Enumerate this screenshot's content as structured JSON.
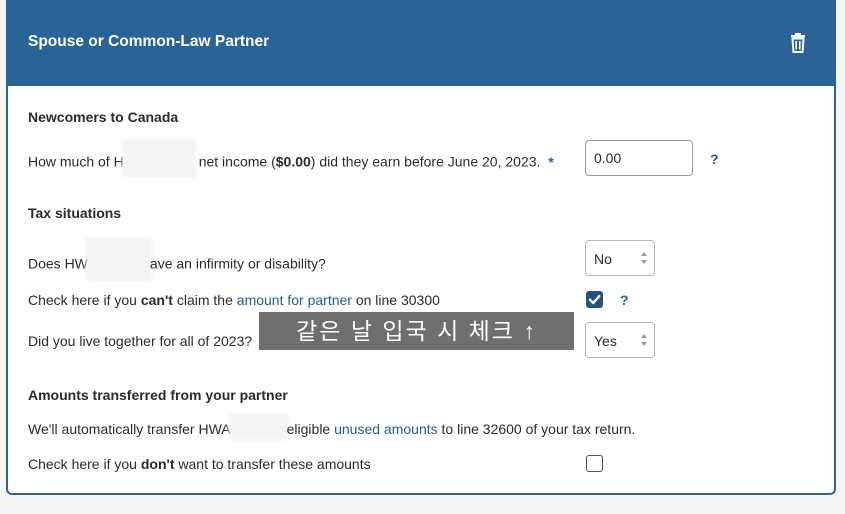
{
  "header": {
    "title": "Spouse or Common-Law Partner",
    "trash_icon": "trash-icon"
  },
  "newcomers": {
    "title": "Newcomers to Canada",
    "q_prefix": "How much of H",
    "q_mid1": "net income (",
    "q_amount": "$0.00",
    "q_suffix": ") did they earn before June 20, 2023.",
    "required_mark": "*",
    "input_value": "0.00",
    "help": "?"
  },
  "tax": {
    "title": "Tax situations",
    "disability_prefix": "Does HW",
    "disability_suffix": "ave an infirmity or disability?",
    "disability_value": "No",
    "claim_prefix": "Check here if you ",
    "claim_bold": "can't",
    "claim_mid": " claim the ",
    "claim_link": "amount for partner",
    "claim_suffix": " on line 30300",
    "claim_checked": true,
    "claim_help": "?",
    "together_q": "Did you live together for all of 2023?",
    "together_value": "Yes"
  },
  "overlay_note": "같은 날 입국 시 체크 ↑",
  "transfer": {
    "title": "Amounts transferred from your partner",
    "auto_prefix": "We'll automatically transfer HWA",
    "auto_mid": "eligible ",
    "auto_link": "unused amounts",
    "auto_suffix": " to line 32600 of your tax return.",
    "dont_prefix": "Check here if you ",
    "dont_bold": "don't",
    "dont_suffix": " want to transfer these amounts",
    "dont_checked": false
  },
  "colors": {
    "header_bg": "#2a6496",
    "link": "#1f5f91",
    "checkbox": "#23527c"
  }
}
